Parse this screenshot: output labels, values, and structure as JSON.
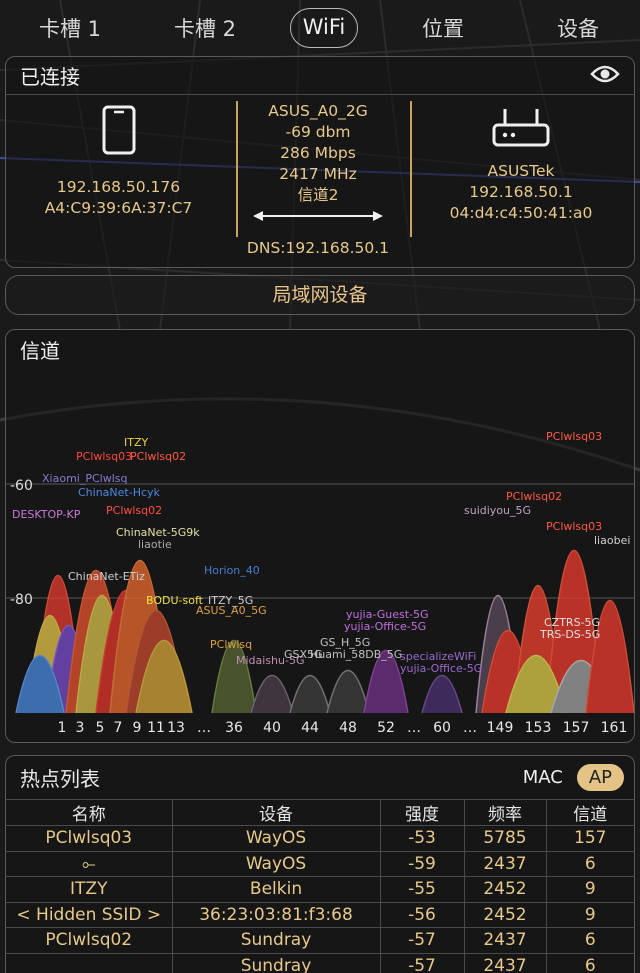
{
  "tabs": [
    {
      "label": "卡槽 1"
    },
    {
      "label": "卡槽 2"
    },
    {
      "label": "WiFi"
    },
    {
      "label": "位置"
    },
    {
      "label": "设备"
    }
  ],
  "connected": {
    "title": "已连接",
    "eye_icon": "eye-icon",
    "phone": {
      "ip": "192.168.50.176",
      "mac": "A4:C9:39:6A:37:C7"
    },
    "link": {
      "ssid": "ASUS_A0_2G",
      "signal": "-69 dbm",
      "speed": "286 Mbps",
      "freq": "2417 MHz",
      "channel": "信道2"
    },
    "dns": "DNS:192.168.50.1",
    "router": {
      "vendor": "ASUSTek",
      "ip": "192.168.50.1",
      "mac": "04:d4:c4:50:41:a0"
    }
  },
  "lan_button": "局域网设备",
  "channel": {
    "title": "信道",
    "ylabels": [
      "-60",
      "-80"
    ],
    "xticks": [
      "1",
      "3",
      "5",
      "7",
      "9",
      "11",
      "13",
      "…",
      "36",
      "40",
      "44",
      "48",
      "52",
      "…",
      "60",
      "…",
      "149",
      "153",
      "157",
      "161"
    ],
    "labels": [
      "PClwlsq03",
      "ITZY",
      "PClwlsq02",
      "Xiaomi_PClwlsq",
      "ChinaNet-Hcyk",
      "DESKTOP-KP",
      "PClwlsq02",
      "ChinaNet-5G9k",
      "liaotie",
      "ChinaNet-ETiz",
      "BODU-soft",
      "Horion_40",
      "ITZY_5G",
      "ASUS_A0_5G",
      "PClwlsq",
      "Midaishu-5G",
      "GSX5G",
      "GS_H_5G",
      "Huami_58DB_5G",
      "yujia-Guest-5G",
      "yujia-Office-5G",
      "specializeWiFi",
      "yujia-Office-5G",
      "suidiyou_5G",
      "PClwlsq03",
      "PClwlsq02",
      "liaobei",
      "CZTRS-5G",
      "TRS-DS-5G",
      "PClwlsq03"
    ]
  },
  "hotspots": {
    "title": "热点列表",
    "mode_mac": "MAC",
    "mode_ap": "AP",
    "columns": [
      "名称",
      "设备",
      "强度",
      "频率",
      "信道"
    ],
    "rows": [
      [
        "PClwlsq03",
        "WayOS",
        "-53",
        "5785",
        "157"
      ],
      [
        "⟜",
        "WayOS",
        "-59",
        "2437",
        "6"
      ],
      [
        "ITZY",
        "Belkin",
        "-55",
        "2452",
        "9"
      ],
      [
        "< Hidden SSID >",
        "36:23:03:81:f3:68",
        "-56",
        "2452",
        "9"
      ],
      [
        "PClwlsq02",
        "Sundray",
        "-57",
        "2437",
        "6"
      ],
      [
        "",
        "Sundray",
        "-57",
        "2437",
        "6"
      ]
    ]
  },
  "colors": {
    "accent": "#e7c98a",
    "active_pill": "#e4c486",
    "background": "#1a1a1a"
  }
}
